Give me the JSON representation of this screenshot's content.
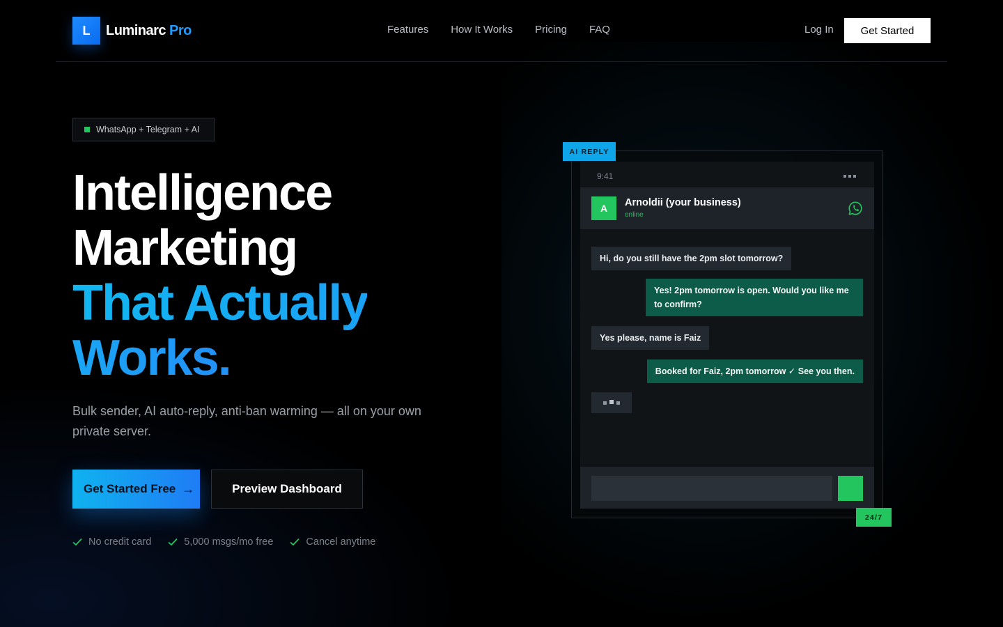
{
  "brand": {
    "mark": "L",
    "name": "Luminarc",
    "suffix": "Pro"
  },
  "nav": {
    "links": [
      "Features",
      "How It Works",
      "Pricing",
      "FAQ"
    ],
    "login": "Log In",
    "cta": "Get Started"
  },
  "hero": {
    "badge": "WhatsApp + Telegram + AI",
    "headline": [
      "Intelligence",
      "Marketing",
      "That Actually",
      "Works."
    ],
    "subtitle": "Bulk sender, AI auto-reply, anti-ban warming — all on your own private server.",
    "primary_cta": "Get Started Free",
    "primary_cta_arrow": "→",
    "secondary_cta": "Preview Dashboard",
    "perks": [
      "No credit card",
      "5,000 msgs/mo free",
      "Cancel anytime"
    ]
  },
  "mockup": {
    "tag_top": "AI REPLY",
    "tag_bottom": "24/7",
    "time": "9:41",
    "contact": {
      "initial": "A",
      "name": "Arnoldii (your business)",
      "status": "online"
    },
    "messages": [
      {
        "side": "in",
        "text": "Hi, do you still have the 2pm slot tomorrow?"
      },
      {
        "side": "out",
        "text": "Yes! 2pm tomorrow is open. Would you like me to confirm?"
      },
      {
        "side": "in",
        "text": "Yes please, name is Faiz"
      },
      {
        "side": "out",
        "text": "Booked for Faiz, 2pm tomorrow ✓ See you then."
      }
    ]
  },
  "colors": {
    "accent_blue": "#1e9bff",
    "accent_green": "#22c55e",
    "bubble_out": "#0d5c49",
    "bubble_in": "#222930"
  }
}
